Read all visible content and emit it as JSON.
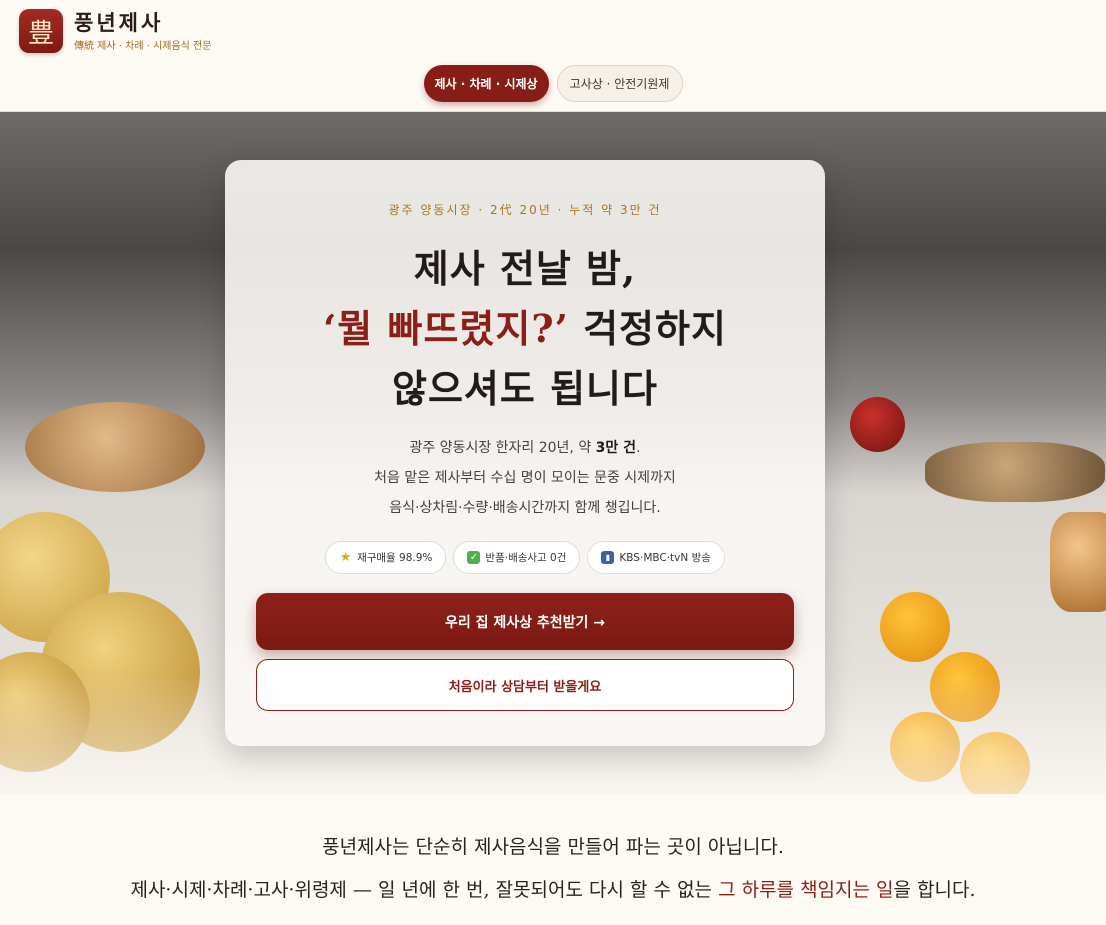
{
  "header": {
    "logo_char": "豊",
    "brand_name": "풍년제사",
    "brand_sub": "傳統 제사 · 차례 · 시제음식 전문"
  },
  "nav": {
    "tab1": "제사 · 차례 · 시제상",
    "tab2": "고사상 · 안전기원제"
  },
  "hero": {
    "eyebrow": "광주 양동시장 · 2代 20년 · 누적 약 3만 건",
    "headline_line1": "제사 전날 밤,",
    "headline_line2_highlight": "‘뭘 빠뜨렸지?’",
    "headline_line2_rest": " 걱정하지",
    "headline_line3": "않으셔도 됩니다",
    "desc_line1_pre": "광주 양동시장 한자리 20년, 약 ",
    "desc_line1_bold": "3만 건",
    "desc_line1_post": ".",
    "desc_line2": "처음 맡은 제사부터 수십 명이 모이는 문중 시제까지",
    "desc_line3": "음식·상차림·수량·배송시간까지 함께 챙깁니다.",
    "badges": [
      {
        "icon": "star-icon",
        "label": "재구매율 98.9%"
      },
      {
        "icon": "check-icon",
        "label": "반품·배송사고 0건"
      },
      {
        "icon": "tv-icon",
        "label": "KBS·MBC·tvN 방송"
      }
    ],
    "cta_primary": "우리 집 제사상 추천받기 →",
    "cta_secondary": "처음이라 상담부터 받을게요"
  },
  "intro": {
    "line1": "풍년제사는 단순히 제사음식을 만들어 파는 곳이 아닙니다.",
    "line2_pre": "제사·시제·차례·고사·위령제 — 일 년에 한 번, 잘못되어도 다시 할 수 없는 ",
    "line2_accent": "그 하루를 책임지는 일",
    "line2_post": "을 합니다."
  },
  "colors": {
    "brand": "#861d16",
    "accent_gold": "#a8741e",
    "background": "#fdfaf4"
  }
}
